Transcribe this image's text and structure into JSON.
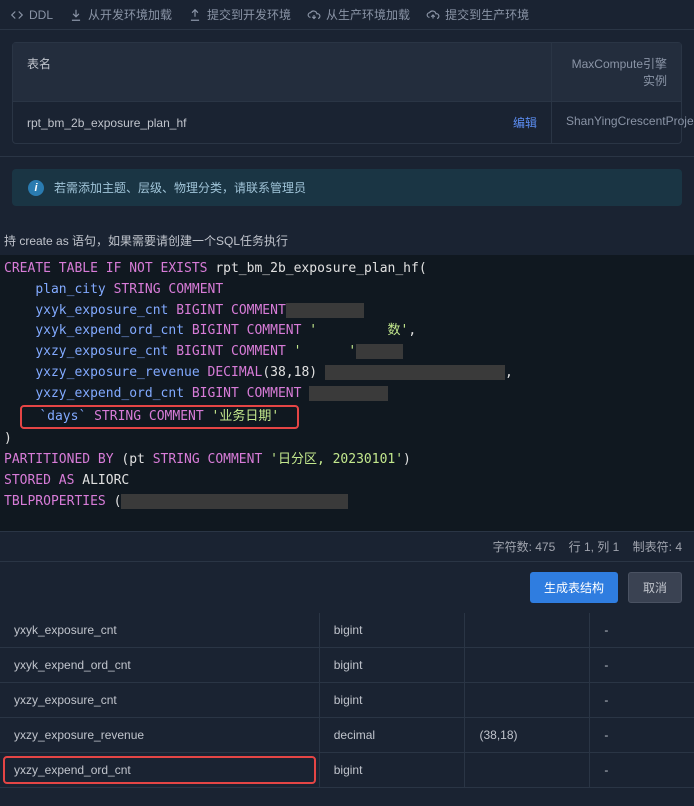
{
  "toolbar": {
    "ddl": "DDL",
    "load_dev": "从开发环境加载",
    "submit_dev": "提交到开发环境",
    "load_prod": "从生产环境加载",
    "submit_prod": "提交到生产环境"
  },
  "table_meta": {
    "name_header": "表名",
    "engine_header": "MaxCompute引擎实例",
    "name_value": "rpt_bm_2b_exposure_plan_hf",
    "engine_value": "ShanYingCrescentProje",
    "edit_label": "编辑"
  },
  "info_text": "若需添加主题、层级、物理分类，请联系管理员",
  "hint_text": "持 create as 语句，如果需要请创建一个SQL任务执行",
  "sql": {
    "create_table": "CREATE TABLE IF NOT EXISTS",
    "table_name": "rpt_bm_2b_exposure_plan_hf",
    "fields": [
      {
        "name": "plan_city",
        "type": "STRING",
        "kw": "COMMENT",
        "str": ""
      },
      {
        "name": "yxyk_exposure_cnt",
        "type": "BIGINT",
        "kw": "COMMENT",
        "str": ""
      },
      {
        "name": "yxyk_expend_ord_cnt",
        "type": "BIGINT",
        "kw": "COMMENT",
        "str": "'         数'"
      },
      {
        "name": "yxzy_exposure_cnt",
        "type": "BIGINT",
        "kw": "COMMENT",
        "str": "'      '"
      },
      {
        "name": "yxzy_exposure_revenue",
        "type": "DECIMAL",
        "args": "(38,18)",
        "str": ""
      },
      {
        "name": "yxzy_expend_ord_cnt",
        "type": "BIGINT",
        "kw": "COMMENT",
        "str": ""
      },
      {
        "name": "`days`",
        "type": "STRING",
        "kw": "COMMENT",
        "str": "'业务日期'"
      }
    ],
    "partitioned": "PARTITIONED BY",
    "partition_spec": "(pt STRING COMMENT '日分区, 20230101')",
    "stored": "STORED AS",
    "stored_val": "ALIORC",
    "tblprops": "TBLPROPERTIES"
  },
  "status": {
    "chars_label": "字符数:",
    "chars_val": "475",
    "line_label": "行 1, 列 1",
    "tabs_label": "制表符: 4"
  },
  "actions": {
    "generate": "生成表结构",
    "cancel": "取消"
  },
  "schema": {
    "rows": [
      {
        "name": "yxyk_exposure_cnt",
        "type": "bigint",
        "size": "",
        "d": "-"
      },
      {
        "name": "yxyk_expend_ord_cnt",
        "type": "bigint",
        "size": "",
        "d": "-"
      },
      {
        "name": "yxzy_exposure_cnt",
        "type": "bigint",
        "size": "",
        "d": "-"
      },
      {
        "name": "yxzy_exposure_revenue",
        "type": "decimal",
        "size": "(38,18)",
        "d": "-"
      },
      {
        "name": "yxzy_expend_ord_cnt",
        "type": "bigint",
        "size": "",
        "d": "-"
      }
    ]
  }
}
